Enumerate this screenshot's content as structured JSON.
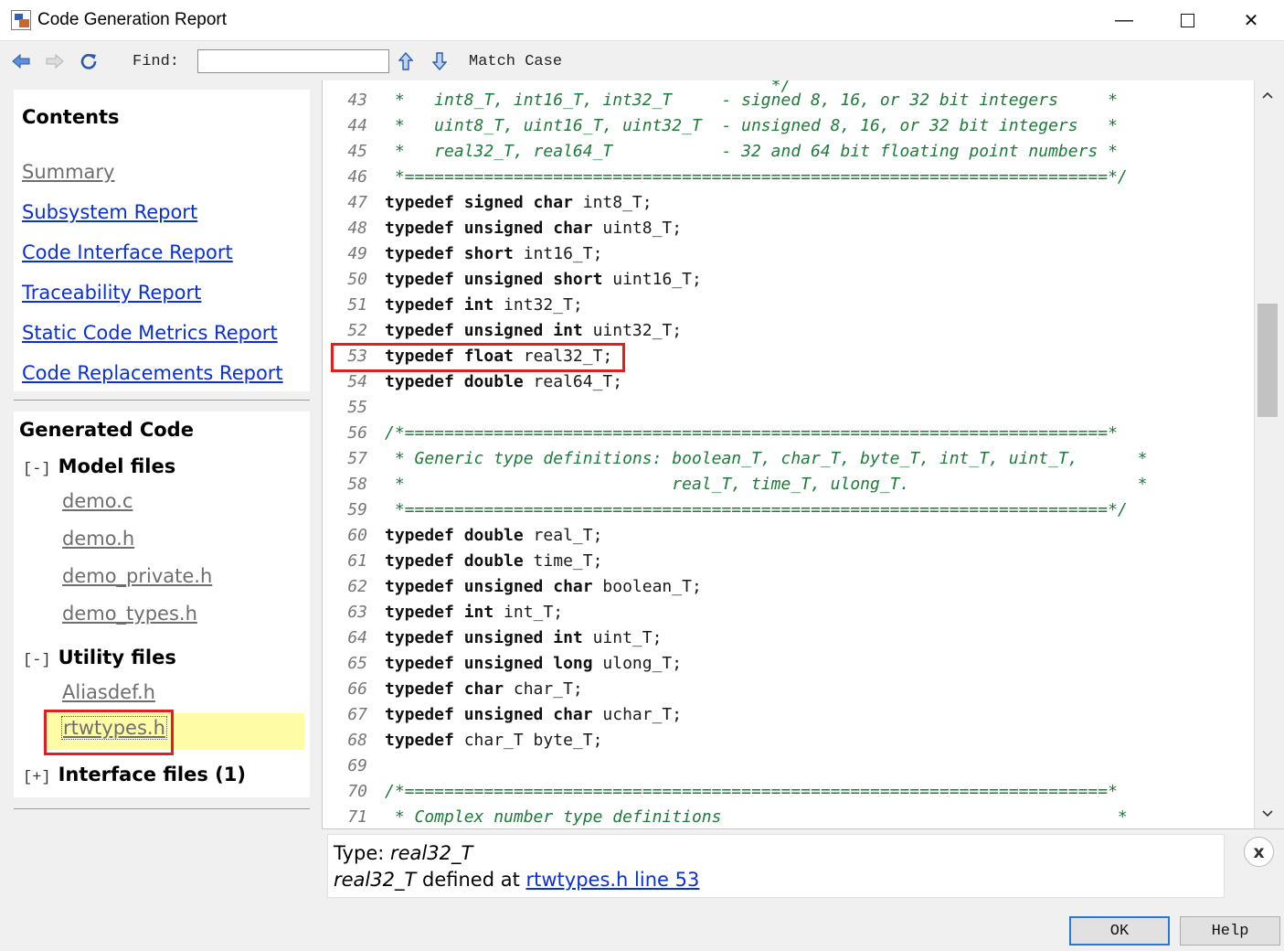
{
  "window": {
    "title": "Code Generation Report",
    "minimize_glyph": "—",
    "close_glyph": "✕"
  },
  "toolbar": {
    "back_icon": "back-arrow-icon",
    "forward_icon": "forward-arrow-icon",
    "refresh_icon": "refresh-icon",
    "find_label": "Find:",
    "find_value": "",
    "match_case_label": "Match Case"
  },
  "contents": {
    "title": "Contents",
    "links": [
      "Summary",
      "Subsystem Report",
      "Code Interface Report",
      "Traceability Report",
      "Static Code Metrics Report",
      "Code Replacements Report"
    ]
  },
  "generated_code": {
    "title": "Generated Code",
    "model_files": {
      "toggle": "[-]",
      "label": "Model files",
      "files": [
        "demo.c",
        "demo.h",
        "demo_private.h",
        "demo_types.h"
      ]
    },
    "utility_files": {
      "toggle": "[-]",
      "label": "Utility files",
      "files": [
        "Aliasdef.h"
      ],
      "selected_file": "rtwtypes.h"
    },
    "interface_files": {
      "toggle": "[+]",
      "label": "Interface files (1)"
    }
  },
  "code": {
    "lines": [
      {
        "n": "43",
        "t": " *   int8_T, int16_T, int32_T     - signed 8, 16, or 32 bit integers     *",
        "c": true
      },
      {
        "n": "44",
        "t": " *   uint8_T, uint16_T, uint32_T  - unsigned 8, 16, or 32 bit integers   *",
        "c": true
      },
      {
        "n": "45",
        "t": " *   real32_T, real64_T           - 32 and 64 bit floating point numbers *",
        "c": true
      },
      {
        "n": "46",
        "t": " *=======================================================================*/",
        "c": true
      },
      {
        "n": "47",
        "kw": "typedef signed char",
        "t": " int8_T;"
      },
      {
        "n": "48",
        "kw": "typedef unsigned char",
        "t": " uint8_T;"
      },
      {
        "n": "49",
        "kw": "typedef short",
        "t": " int16_T;"
      },
      {
        "n": "50",
        "kw": "typedef unsigned short",
        "t": " uint16_T;"
      },
      {
        "n": "51",
        "kw": "typedef int",
        "t": " int32_T;"
      },
      {
        "n": "52",
        "kw": "typedef unsigned int",
        "t": " uint32_T;"
      },
      {
        "n": "53",
        "kw": "typedef float",
        "t": " real32_T;"
      },
      {
        "n": "54",
        "kw": "typedef double",
        "t": " real64_T;"
      },
      {
        "n": "55",
        "t": ""
      },
      {
        "n": "56",
        "t": "/*=======================================================================*",
        "c": true
      },
      {
        "n": "57",
        "t": " * Generic type definitions: boolean_T, char_T, byte_T, int_T, uint_T,      *",
        "c": true
      },
      {
        "n": "58",
        "t": " *                           real_T, time_T, ulong_T.                       *",
        "c": true
      },
      {
        "n": "59",
        "t": " *=======================================================================*/",
        "c": true
      },
      {
        "n": "60",
        "kw": "typedef double",
        "t": " real_T;"
      },
      {
        "n": "61",
        "kw": "typedef double",
        "t": " time_T;"
      },
      {
        "n": "62",
        "kw": "typedef unsigned char",
        "t": " boolean_T;"
      },
      {
        "n": "63",
        "kw": "typedef int",
        "t": " int_T;"
      },
      {
        "n": "64",
        "kw": "typedef unsigned int",
        "t": " uint_T;"
      },
      {
        "n": "65",
        "kw": "typedef unsigned long",
        "t": " ulong_T;"
      },
      {
        "n": "66",
        "kw": "typedef char",
        "t": " char_T;"
      },
      {
        "n": "67",
        "kw": "typedef unsigned char",
        "t": " uchar_T;"
      },
      {
        "n": "68",
        "kw": "typedef",
        "t": " char_T byte_T;"
      },
      {
        "n": "69",
        "t": ""
      },
      {
        "n": "70",
        "t": "/*=======================================================================*",
        "c": true
      },
      {
        "n": "71",
        "t": " * Complex number type definitions                                        *",
        "c": true
      }
    ]
  },
  "info": {
    "type_label": "Type: ",
    "type_value": "real32_T",
    "def_name": "real32_T",
    "def_text": " defined at ",
    "def_link": "rtwtypes.h line 53",
    "close_label": "x"
  },
  "buttons": {
    "ok": "OK",
    "help": "Help"
  }
}
